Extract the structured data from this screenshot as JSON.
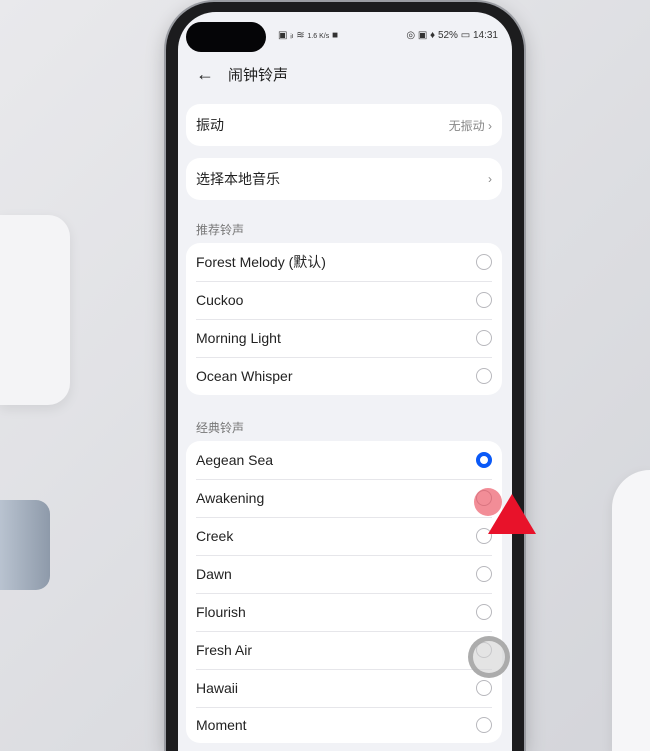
{
  "status": {
    "network_speed": "1.6 K/s",
    "battery": "52%",
    "time": "14:31"
  },
  "header": {
    "back_icon": "arrow-left-icon",
    "title": "闹钟铃声"
  },
  "vibration": {
    "label": "振动",
    "value": "无振动"
  },
  "local_music": {
    "label": "选择本地音乐"
  },
  "recommended": {
    "title": "推荐铃声",
    "items": [
      {
        "label": "Forest Melody (默认)",
        "selected": false
      },
      {
        "label": "Cuckoo",
        "selected": false
      },
      {
        "label": "Morning Light",
        "selected": false
      },
      {
        "label": "Ocean Whisper",
        "selected": false
      }
    ]
  },
  "classic": {
    "title": "经典铃声",
    "items": [
      {
        "label": "Aegean Sea",
        "selected": true
      },
      {
        "label": "Awakening",
        "selected": false
      },
      {
        "label": "Creek",
        "selected": false
      },
      {
        "label": "Dawn",
        "selected": false
      },
      {
        "label": "Flourish",
        "selected": false
      },
      {
        "label": "Fresh Air",
        "selected": false
      },
      {
        "label": "Hawaii",
        "selected": false
      },
      {
        "label": "Moment",
        "selected": false
      }
    ]
  },
  "colors": {
    "accent": "#0a59f7",
    "pointer": "#e8122a"
  }
}
